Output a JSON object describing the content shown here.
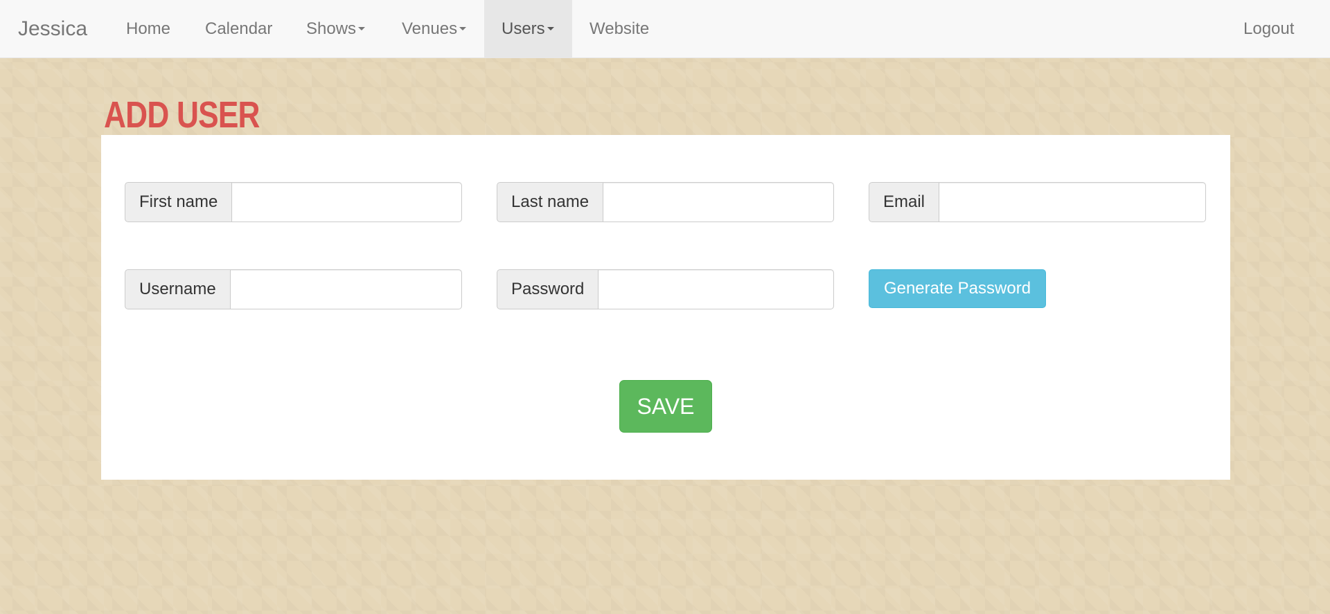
{
  "navbar": {
    "brand": "Jessica",
    "items": [
      {
        "label": "Home"
      },
      {
        "label": "Calendar"
      },
      {
        "label": "Shows"
      },
      {
        "label": "Venues"
      },
      {
        "label": "Users"
      },
      {
        "label": "Website"
      }
    ],
    "active_item": "Users",
    "logout": "Logout"
  },
  "page": {
    "title": "Add User"
  },
  "form": {
    "first_name": {
      "label": "First name",
      "value": ""
    },
    "last_name": {
      "label": "Last name",
      "value": ""
    },
    "email": {
      "label": "Email",
      "value": ""
    },
    "username": {
      "label": "Username",
      "value": ""
    },
    "password": {
      "label": "Password",
      "value": ""
    },
    "generate_password_label": "Generate Password",
    "save_label": "SAVE"
  },
  "icons": {
    "dropdown": "caret-down-icon"
  },
  "colors": {
    "title": "#d9534f",
    "info_button": "#5bc0de",
    "success_button": "#5cb85c",
    "background": "#e6d7b8"
  }
}
